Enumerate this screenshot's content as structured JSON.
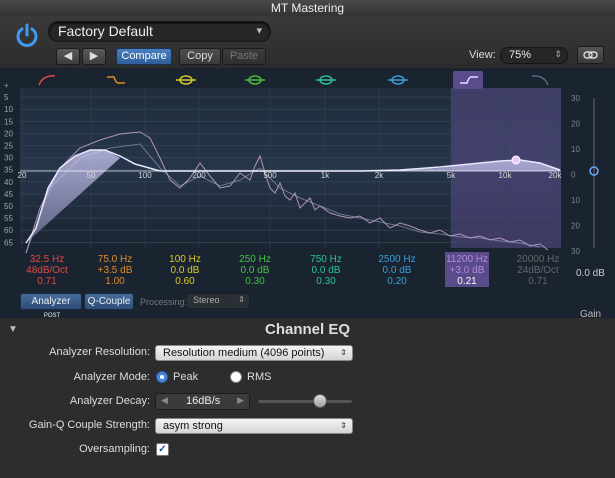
{
  "window": {
    "title": "MT Mastering"
  },
  "header": {
    "preset": "Factory Default",
    "prev_label": "◀",
    "next_label": "▶",
    "compare_label": "Compare",
    "copy_label": "Copy",
    "paste_label": "Paste",
    "view_label": "View:",
    "view_value": "75%"
  },
  "graph": {
    "db_left": [
      "+",
      "5",
      "10",
      "15",
      "20",
      "25",
      "30",
      "35",
      "40",
      "45",
      "50",
      "55",
      "60",
      "65"
    ],
    "db_right": [
      "30",
      "20",
      "10",
      "0",
      "10",
      "20",
      "30"
    ],
    "freq_ticks": [
      "20",
      "50",
      "100",
      "200",
      "500",
      "1k",
      "2k",
      "5k",
      "10k",
      "20k"
    ]
  },
  "bands": [
    {
      "freq": "32.5 Hz",
      "gain": "48dB/Oct",
      "q": "0.71",
      "color": "#e04848"
    },
    {
      "freq": "75.0 Hz",
      "gain": "+3.5 dB",
      "q": "1.00",
      "color": "#e08a2a"
    },
    {
      "freq": "100 Hz",
      "gain": "0.0 dB",
      "q": "0.60",
      "color": "#d9c82e"
    },
    {
      "freq": "250 Hz",
      "gain": "0.0 dB",
      "q": "0.30",
      "color": "#43c243"
    },
    {
      "freq": "750 Hz",
      "gain": "0.0 dB",
      "q": "0.30",
      "color": "#2fbf9f"
    },
    {
      "freq": "2500 Hz",
      "gain": "0.0 dB",
      "q": "0.20",
      "color": "#3a9fd8"
    },
    {
      "freq": "11200 Hz",
      "gain": "+3.0 dB",
      "q": "0.21",
      "color": "#b08ae0"
    },
    {
      "freq": "20000 Hz",
      "gain": "24dB/Oct",
      "q": "0.71",
      "color": "#666"
    }
  ],
  "gain": {
    "label": "Gain",
    "value": "0.0 dB"
  },
  "controls": {
    "analyzer_label": "Analyzer",
    "analyzer_post": "POST",
    "qcouple_label": "Q-Couple",
    "processing_label": "Processing:",
    "processing_value": "Stereo"
  },
  "panel": {
    "title": "Channel EQ",
    "analyzer_resolution_label": "Analyzer Resolution:",
    "analyzer_resolution_value": "Resolution medium (4096 points)",
    "analyzer_mode_label": "Analyzer Mode:",
    "mode_peak": "Peak",
    "mode_rms": "RMS",
    "analyzer_decay_label": "Analyzer Decay:",
    "analyzer_decay_value": "16dB/s",
    "gainq_label": "Gain-Q Couple Strength:",
    "gainq_value": "asym strong",
    "oversampling_label": "Oversampling:"
  },
  "colors": {
    "accent": "#4a86d8",
    "curve": "#c7c3f0",
    "highlight": "#b08ae0"
  }
}
